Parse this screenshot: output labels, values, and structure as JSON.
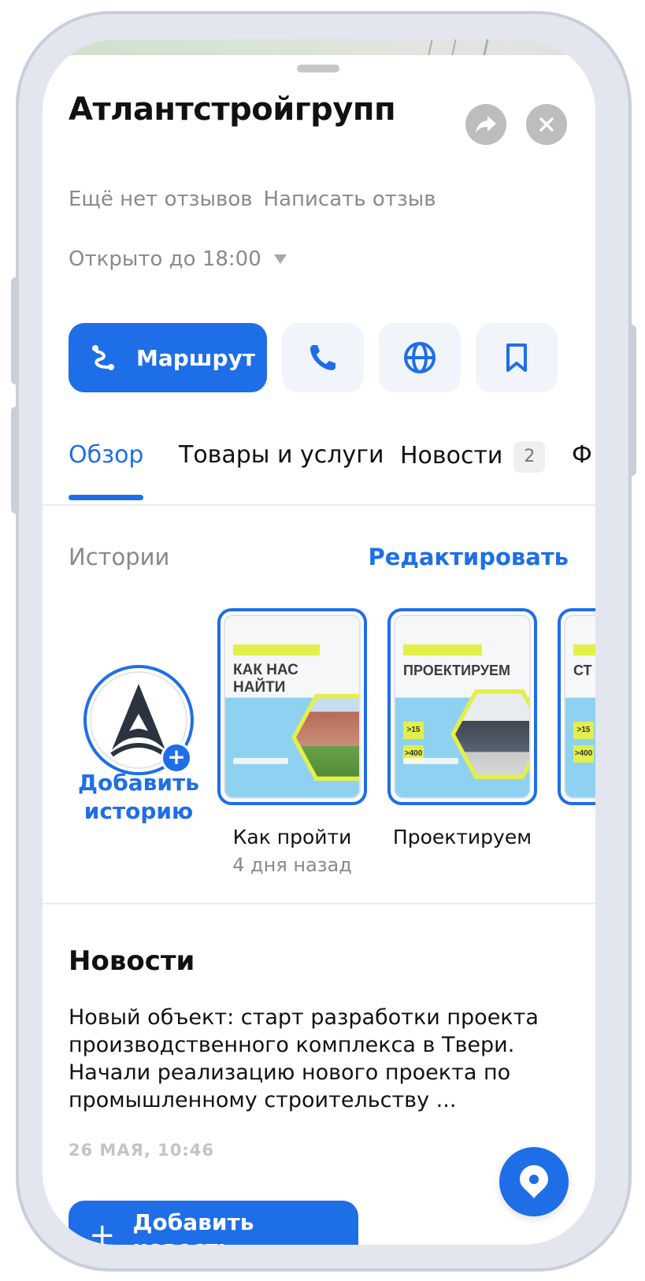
{
  "place": {
    "title": "Атлантстройгрупп",
    "reviews_none": "Ещё нет отзывов",
    "write_review": "Написать отзыв",
    "hours": "Открыто до 18:00"
  },
  "actions": {
    "route_label": "Маршрут"
  },
  "tabs": [
    {
      "label": "Обзор",
      "active": true
    },
    {
      "label": "Товары и услуги",
      "active": false
    },
    {
      "label": "Новости",
      "badge": "2",
      "active": false
    },
    {
      "label": "Ф",
      "active": false
    }
  ],
  "stories": {
    "heading": "Истории",
    "edit": "Редактировать",
    "add_label": "Добавить историю",
    "add_plus": "+",
    "items": [
      {
        "caption": "Как пройти",
        "subtitle": "4 дня назад",
        "headline": "КАК НАС НАЙТИ"
      },
      {
        "caption": "Проектируем",
        "subtitle": "",
        "headline": "ПРОЕКТИРУЕМ",
        "stats": [
          ">15",
          ">400"
        ]
      },
      {
        "caption": "",
        "subtitle": "",
        "headline": "СТ",
        "stats": [
          ">15",
          ">400"
        ]
      }
    ]
  },
  "news": {
    "heading": "Новости",
    "body": "Новый объект: старт разработки проекта производственного комплекса в Твери. Начали реализацию нового проекта по промышленному строительству ...",
    "date": "26 МАЯ, 10:46",
    "add_label": "Добавить новость",
    "add_plus": "+"
  },
  "colors": {
    "accent": "#1e6ee8",
    "muted_text": "#8a8a8a",
    "story_yellow": "#e3ef4a",
    "story_blue": "#8fd1f0"
  },
  "icons": [
    "share-icon",
    "close-icon",
    "route-icon",
    "phone-icon",
    "globe-icon",
    "bookmark-icon",
    "company-logo",
    "map-pin-icon"
  ]
}
